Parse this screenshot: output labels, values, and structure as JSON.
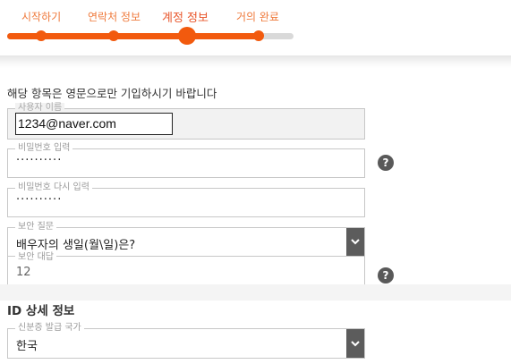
{
  "stepper": {
    "steps": [
      {
        "label": "시작하기",
        "state": "done"
      },
      {
        "label": "연락처 정보",
        "state": "done"
      },
      {
        "label": "계정 정보",
        "state": "current"
      },
      {
        "label": "거의 완료",
        "state": "upcoming"
      }
    ],
    "progress": 0.88,
    "accent_color": "#f25a0e"
  },
  "form": {
    "instruction": "해당 항목은 영문으로만 기입하시기 바랍니다",
    "username": {
      "label": "사용자 이름",
      "value": "1234@naver.com"
    },
    "password": {
      "label": "비밀번호 입력",
      "value": "··········"
    },
    "password_confirm": {
      "label": "비밀번호 다시 입력",
      "value": "··········"
    },
    "security_question": {
      "label": "보안 질문",
      "value": "배우자의 생일(월\\일)은?"
    },
    "security_answer": {
      "label": "보안 대답",
      "value": "12"
    },
    "help_icon": "?"
  },
  "id_details": {
    "title": "ID 상세 정보",
    "issuing_country": {
      "label": "신분증 발급 국가",
      "value": "한국"
    }
  }
}
